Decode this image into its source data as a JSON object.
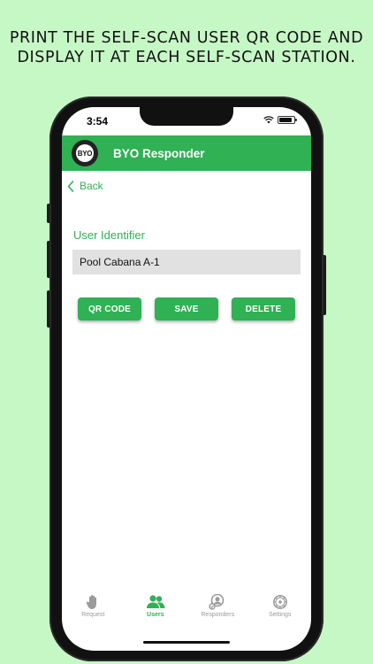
{
  "caption": "PRINT THE SELF-SCAN USER QR CODE AND\nDISPLAY IT AT EACH SELF-SCAN STATION.",
  "status_bar": {
    "time": "3:54"
  },
  "navbar": {
    "logo_text": "BYO",
    "title": "BYO Responder",
    "color": "#2fb154"
  },
  "back": {
    "label": "Back"
  },
  "form": {
    "field_label": "User Identifier",
    "field_value": "Pool Cabana A-1"
  },
  "buttons": {
    "qr_code": "QR CODE",
    "save": "SAVE",
    "delete": "DELETE"
  },
  "tabbar": {
    "tabs": [
      {
        "label": "Request",
        "icon": "hand-icon",
        "active": false
      },
      {
        "label": "Users",
        "icon": "users-icon",
        "active": true
      },
      {
        "label": "Responders",
        "icon": "responder-icon",
        "active": false
      },
      {
        "label": "Settings",
        "icon": "gear-icon",
        "active": false
      }
    ]
  },
  "colors": {
    "background": "#c6f8c6",
    "accent": "#2fb154",
    "inactive": "#9a9a9a"
  }
}
